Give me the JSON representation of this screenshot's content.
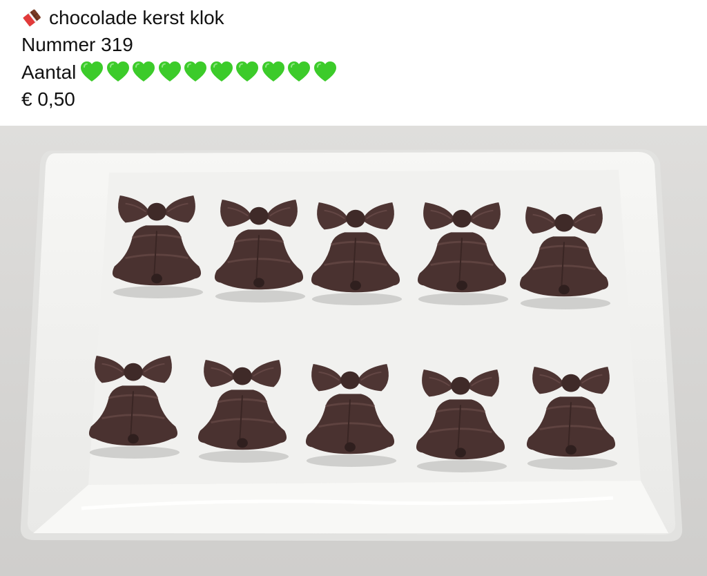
{
  "post": {
    "icon": "chocolate-bar-icon",
    "title": "chocolade kerst klok",
    "number": "Nummer 319",
    "quantity_label": "Aantal",
    "quantity_icon": "green-heart-icon",
    "quantity_count": 10,
    "price": "€ 0,50"
  },
  "photo": {
    "subject": "ten chocolate Christmas bell figures on a white rectangular plate",
    "colors": {
      "chocolate": "#4a3230",
      "plate": "#f3f3f1",
      "heart": "#3ccb2a"
    }
  }
}
